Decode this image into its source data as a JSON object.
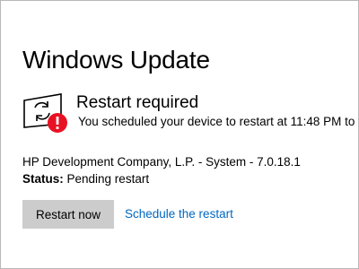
{
  "page": {
    "title": "Windows Update"
  },
  "status": {
    "icon": "restart-required-icon",
    "heading": "Restart required",
    "message": "You scheduled your device to restart at 11:48 PM to"
  },
  "update": {
    "name": "HP Development Company, L.P. - System - 7.0.18.1",
    "status_label": "Status:",
    "status_value": " Pending restart"
  },
  "actions": {
    "restart_now_label": "Restart now",
    "schedule_label": "Schedule the restart"
  },
  "colors": {
    "link": "#0067c0",
    "button_bg": "#cccccc",
    "alert_red": "#e81123"
  }
}
